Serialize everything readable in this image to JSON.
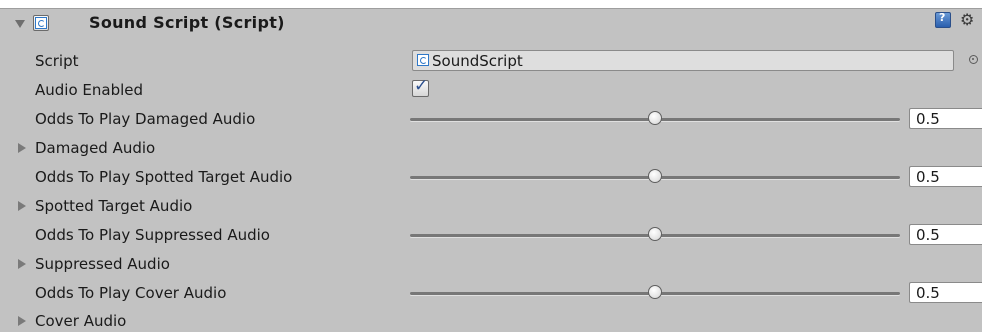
{
  "component": {
    "title": "Sound Script (Script)",
    "icons": [
      "chevron-down-icon",
      "script-icon",
      "help-icon",
      "gear-icon"
    ]
  },
  "script_field": {
    "label": "Script",
    "value": "SoundScript"
  },
  "audio_enabled": {
    "label": "Audio Enabled",
    "checked": true,
    "check_glyph": "✓"
  },
  "sliders": [
    {
      "label": "Odds To Play Damaged Audio",
      "value": "0.5",
      "fraction": 0.5
    },
    {
      "label": "Odds To Play Spotted Target Audio",
      "value": "0.5",
      "fraction": 0.5
    },
    {
      "label": "Odds To Play Suppressed Audio",
      "value": "0.5",
      "fraction": 0.5
    },
    {
      "label": "Odds To Play Cover Audio",
      "value": "0.5",
      "fraction": 0.5
    }
  ],
  "foldouts": [
    {
      "label": "Damaged Audio"
    },
    {
      "label": "Spotted Target Audio"
    },
    {
      "label": "Suppressed Audio"
    },
    {
      "label": "Cover Audio"
    }
  ],
  "colors": {
    "panel_bg": "#c2c2c2",
    "checkmark": "#2b4f8f",
    "script_icon_blue": "#2f78c8"
  }
}
